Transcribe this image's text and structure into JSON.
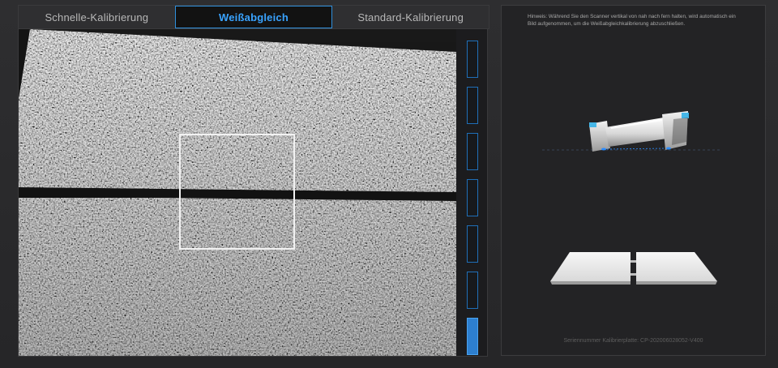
{
  "tabs": [
    {
      "label": "Schnelle-Kalibrierung",
      "active": false
    },
    {
      "label": "Weißabgleich",
      "active": true
    },
    {
      "label": "Standard-Kalibrierung",
      "active": false
    }
  ],
  "progress": {
    "total_steps": 7,
    "completed_steps": 1
  },
  "side_panel": {
    "hint": "Hinweis: Während Sie den Scanner vertikal von nah nach fern halten, wird automatisch ein Bild aufgenommen, um die Weißabgleichkalibrierung abzuschließen.",
    "serial_label": "Seriennummer Kalibrierplatte:",
    "serial_value": "CP-202006028052-V400"
  },
  "colors": {
    "accent": "#39a3ff",
    "active_border": "#2f8fdc",
    "progress_fill": "#2d7fcf"
  },
  "icons": {
    "scanner": "handheld-3d-scanner-icon",
    "plate": "calibration-plate-icon"
  }
}
